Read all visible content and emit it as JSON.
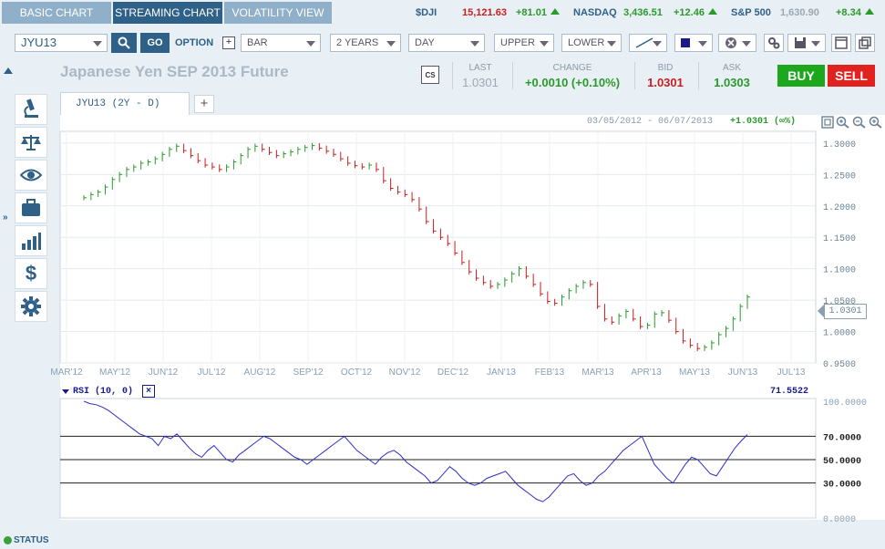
{
  "tabs": [
    {
      "label": "BASIC CHART"
    },
    {
      "label": "STREAMING CHART"
    },
    {
      "label": "VOLATILITY VIEW"
    }
  ],
  "tickers": [
    {
      "name": "$DJI",
      "value": "15,121.63",
      "change": "+81.01"
    },
    {
      "name": "NASDAQ",
      "value": "3,436.51",
      "change": "+12.46"
    },
    {
      "name": "S&P 500",
      "value": "1,630.90",
      "change": "+8.34"
    }
  ],
  "toolbar": {
    "symbol": "JYU13",
    "search_icon": "search-icon",
    "go_label": "GO",
    "option_label": "OPTION",
    "chart_type": "BAR",
    "range": "2 YEARS",
    "interval": "DAY",
    "upper": "UPPER",
    "lower": "LOWER"
  },
  "title": "Japanese Yen SEP 2013 Future",
  "quote": {
    "cs_label": "CS",
    "last_label": "LAST",
    "last": "1.0301",
    "change_label": "CHANGE",
    "change": "+0.0010 (+0.10%)",
    "bid_label": "BID",
    "bid": "1.0301",
    "ask_label": "ASK",
    "ask": "1.0303",
    "buy": "BUY",
    "sell": "SELL"
  },
  "chart_tab": {
    "label": "JYU13 (2Y - D)",
    "add": "+"
  },
  "chart_header": {
    "dates": "03/05/2012 - 06/07/2013",
    "last": "+1.0301 (∞%)"
  },
  "price_label": "1.0301",
  "status": "STATUS",
  "colors": {
    "up": "#2a9a2a",
    "down": "#c81e1e",
    "accent": "#2f6088",
    "rsi": "#2e2ec8"
  },
  "chart_data": [
    {
      "type": "bar",
      "x_labels": [
        "MAR'12",
        "MAY'12",
        "JUN'12",
        "JUL'12",
        "AUG'12",
        "SEP'12",
        "OCT'12",
        "NOV'12",
        "DEC'12",
        "JAN'13",
        "FEB'13",
        "MAR'13",
        "APR'13",
        "MAY'13",
        "JUN'13",
        "JUL'13"
      ],
      "y_ticks": [
        "1.3000",
        "1.2500",
        "1.2000",
        "1.1500",
        "1.1000",
        "1.0500",
        "1.0000",
        "0.9500"
      ],
      "ylim": [
        0.95,
        1.31
      ],
      "series": [
        {
          "values": [
            1.213,
            1.218,
            1.222,
            1.23,
            1.242,
            1.25,
            1.258,
            1.262,
            1.268,
            1.27,
            1.275,
            1.282,
            1.29,
            1.295,
            1.288,
            1.28,
            1.272,
            1.265,
            1.262,
            1.258,
            1.262,
            1.27,
            1.28,
            1.29,
            1.295,
            1.29,
            1.285,
            1.28,
            1.283,
            1.286,
            1.29,
            1.293,
            1.296,
            1.292,
            1.287,
            1.282,
            1.275,
            1.268,
            1.264,
            1.262,
            1.265,
            1.258,
            1.24,
            1.228,
            1.222,
            1.218,
            1.21,
            1.195,
            1.175,
            1.16,
            1.15,
            1.14,
            1.125,
            1.11,
            1.095,
            1.085,
            1.078,
            1.072,
            1.075,
            1.082,
            1.092,
            1.1,
            1.088,
            1.075,
            1.06,
            1.048,
            1.045,
            1.055,
            1.065,
            1.072,
            1.078,
            1.075,
            1.04,
            1.02,
            1.015,
            1.025,
            1.032,
            1.02,
            1.008,
            1.01,
            1.028,
            1.03,
            1.018,
            1.0,
            0.985,
            0.978,
            0.973,
            0.975,
            0.982,
            0.995,
            1.005,
            1.02,
            1.04,
            1.055
          ]
        }
      ]
    },
    {
      "type": "line",
      "title": "RSI (10, 0)",
      "last_value": "71.5522",
      "y_ticks": [
        "100.0000",
        "70.0000",
        "50.0000",
        "30.0000",
        "0.0000"
      ],
      "ylim": [
        0,
        100
      ],
      "series": [
        {
          "values": [
            100,
            98,
            97,
            95,
            92,
            88,
            84,
            80,
            76,
            72,
            70,
            68,
            62,
            70,
            68,
            72,
            66,
            60,
            55,
            52,
            58,
            62,
            56,
            50,
            48,
            54,
            58,
            62,
            66,
            70,
            68,
            64,
            60,
            56,
            52,
            50,
            46,
            50,
            54,
            58,
            62,
            66,
            70,
            64,
            58,
            54,
            50,
            46,
            52,
            56,
            58,
            54,
            48,
            44,
            40,
            36,
            30,
            32,
            38,
            44,
            40,
            34,
            30,
            28,
            30,
            34,
            36,
            38,
            40,
            34,
            28,
            24,
            20,
            16,
            14,
            18,
            24,
            30,
            36,
            38,
            32,
            28,
            30,
            36,
            40,
            46,
            52,
            58,
            62,
            66,
            70,
            58,
            46,
            40,
            34,
            30,
            38,
            46,
            52,
            50,
            44,
            38,
            36,
            44,
            52,
            60,
            66,
            71.5
          ]
        }
      ]
    }
  ]
}
